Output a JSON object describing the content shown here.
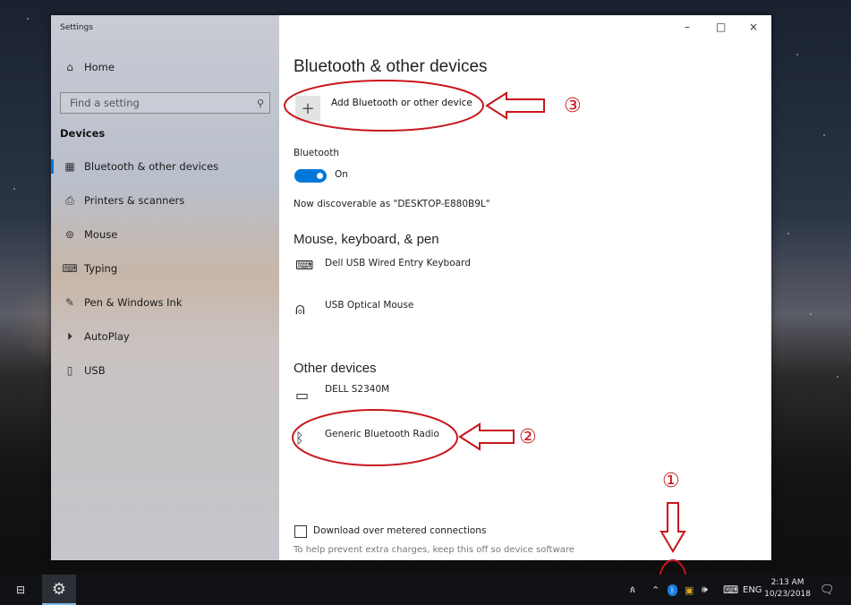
{
  "window": {
    "title": "Settings",
    "controls": {
      "minimize": "–",
      "maximize": "□",
      "close": "×"
    }
  },
  "sidebar": {
    "home_label": "Home",
    "search_placeholder": "Find a setting",
    "section": "Devices",
    "items": [
      {
        "label": "Bluetooth & other devices",
        "icon": "bluetooth-devices-icon",
        "glyph": "▦",
        "active": true
      },
      {
        "label": "Printers & scanners",
        "icon": "printer-icon",
        "glyph": "⎙"
      },
      {
        "label": "Mouse",
        "icon": "mouse-icon",
        "glyph": "⊚"
      },
      {
        "label": "Typing",
        "icon": "keyboard-icon",
        "glyph": "⌨"
      },
      {
        "label": "Pen & Windows Ink",
        "icon": "pen-icon",
        "glyph": "✎"
      },
      {
        "label": "AutoPlay",
        "icon": "autoplay-icon",
        "glyph": "⏵"
      },
      {
        "label": "USB",
        "icon": "usb-icon",
        "glyph": "▯"
      }
    ]
  },
  "main": {
    "heading": "Bluetooth & other devices",
    "add_device_label": "Add Bluetooth or other device",
    "bluetooth_label": "Bluetooth",
    "toggle_state": "On",
    "discoverable": "Now discoverable as \"DESKTOP-E880B9L\"",
    "mkp_heading": "Mouse, keyboard, & pen",
    "mkp_devices": [
      "Dell USB Wired Entry Keyboard",
      "USB Optical Mouse"
    ],
    "other_heading": "Other devices",
    "other_devices": [
      "DELL S2340M",
      "Generic Bluetooth Radio"
    ],
    "metered_label": "Download over metered connections",
    "metered_hint": "To help prevent extra charges, keep this off so device software"
  },
  "annotations": {
    "one": "①",
    "two": "②",
    "three": "③",
    "color": "#c8161d"
  },
  "taskbar": {
    "language": "ENG",
    "time": "2:13 AM",
    "date": "10/23/2018",
    "people_icon": "people-icon",
    "accent": "#0078d7"
  }
}
